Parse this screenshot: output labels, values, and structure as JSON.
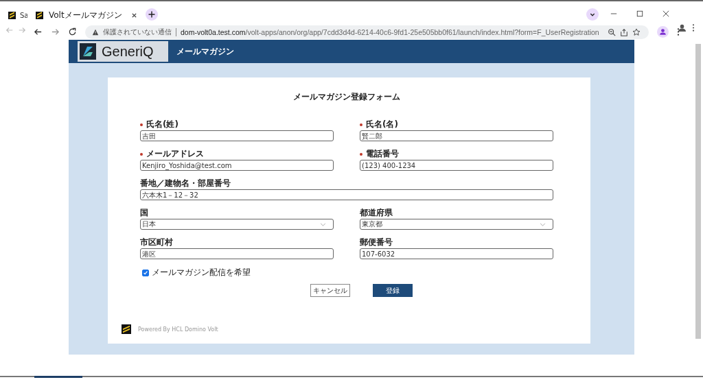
{
  "background_window": {
    "tab_title": "Sa"
  },
  "browser": {
    "tab_title": "Voltメールマガジン",
    "security_label": "保護されていない通信",
    "url_host": "dom-volt0a.test.com",
    "url_path": "/volt-apps/anon/org/app/7cdd3d4d-6214-40c6-9fd1-25e505bb0f61/launch/index.html?form=F_UserRegistration"
  },
  "header": {
    "logo_text": "GeneriQ",
    "app_title": "メールマガジン"
  },
  "form": {
    "title": "メールマガジン登録フォーム",
    "rows": [
      [
        {
          "label": "氏名(姓)",
          "required": true,
          "kind": "text",
          "value": "吉田"
        },
        {
          "label": "氏名(名)",
          "required": true,
          "kind": "text",
          "value": "賢二郎"
        }
      ],
      [
        {
          "label": "メールアドレス",
          "required": true,
          "kind": "text",
          "value": "Kenjiro_Yoshida@test.com"
        },
        {
          "label": "電話番号",
          "required": true,
          "kind": "text",
          "value": "(123) 400-1234"
        }
      ],
      [
        {
          "label": "番地／建物名・部屋番号",
          "required": false,
          "kind": "text",
          "value": "六本木1－12－32"
        }
      ],
      [
        {
          "label": "国",
          "required": false,
          "kind": "select",
          "value": "日本"
        },
        {
          "label": "都道府県",
          "required": false,
          "kind": "select",
          "value": "東京都"
        }
      ],
      [
        {
          "label": "市区町村",
          "required": false,
          "kind": "text",
          "value": "港区"
        },
        {
          "label": "郵便番号",
          "required": false,
          "kind": "text",
          "value": "107-6032"
        }
      ]
    ],
    "checkbox": {
      "label": "メールマガジン配信を希望",
      "checked": true
    },
    "buttons": [
      {
        "label": "キャンセル",
        "kind": "secondary"
      },
      {
        "label": "登録",
        "kind": "primary"
      }
    ]
  },
  "footer": {
    "text": "Powered By HCL Domino Volt"
  }
}
